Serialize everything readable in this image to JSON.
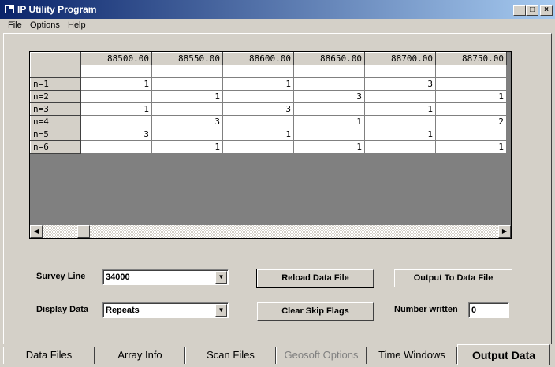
{
  "window": {
    "title": "IP Utility Program",
    "controls": [
      "_",
      "□",
      "×"
    ]
  },
  "menubar": [
    "File",
    "Options",
    "Help"
  ],
  "grid": {
    "columns": [
      "88500.00",
      "88550.00",
      "88600.00",
      "88650.00",
      "88700.00",
      "88750.00"
    ],
    "rows": [
      {
        "label": "",
        "cells": [
          "",
          "",
          "",
          "",
          "",
          ""
        ]
      },
      {
        "label": "n=1",
        "cells": [
          "1",
          "",
          "1",
          "",
          "3",
          ""
        ]
      },
      {
        "label": "n=2",
        "cells": [
          "",
          "1",
          "",
          "3",
          "",
          "1"
        ]
      },
      {
        "label": "n=3",
        "cells": [
          "1",
          "",
          "3",
          "",
          "1",
          ""
        ]
      },
      {
        "label": "n=4",
        "cells": [
          "",
          "3",
          "",
          "1",
          "",
          "2"
        ]
      },
      {
        "label": "n=5",
        "cells": [
          "3",
          "",
          "1",
          "",
          "1",
          ""
        ]
      },
      {
        "label": "n=6",
        "cells": [
          "",
          "1",
          "",
          "1",
          "",
          "1"
        ]
      }
    ]
  },
  "controls": {
    "survey_line_label": "Survey Line",
    "survey_line_value": "34000",
    "display_data_label": "Display Data",
    "display_data_value": "Repeats",
    "reload_button": "Reload Data File",
    "clear_button": "Clear Skip Flags",
    "output_button": "Output To Data File",
    "number_written_label": "Number written",
    "number_written_value": "0"
  },
  "tabs": [
    {
      "label": "Data Files",
      "state": "normal"
    },
    {
      "label": "Array Info",
      "state": "normal"
    },
    {
      "label": "Scan Files",
      "state": "normal"
    },
    {
      "label": "Geosoft Options",
      "state": "disabled"
    },
    {
      "label": "Time Windows",
      "state": "normal"
    },
    {
      "label": "Output Data",
      "state": "active"
    }
  ]
}
